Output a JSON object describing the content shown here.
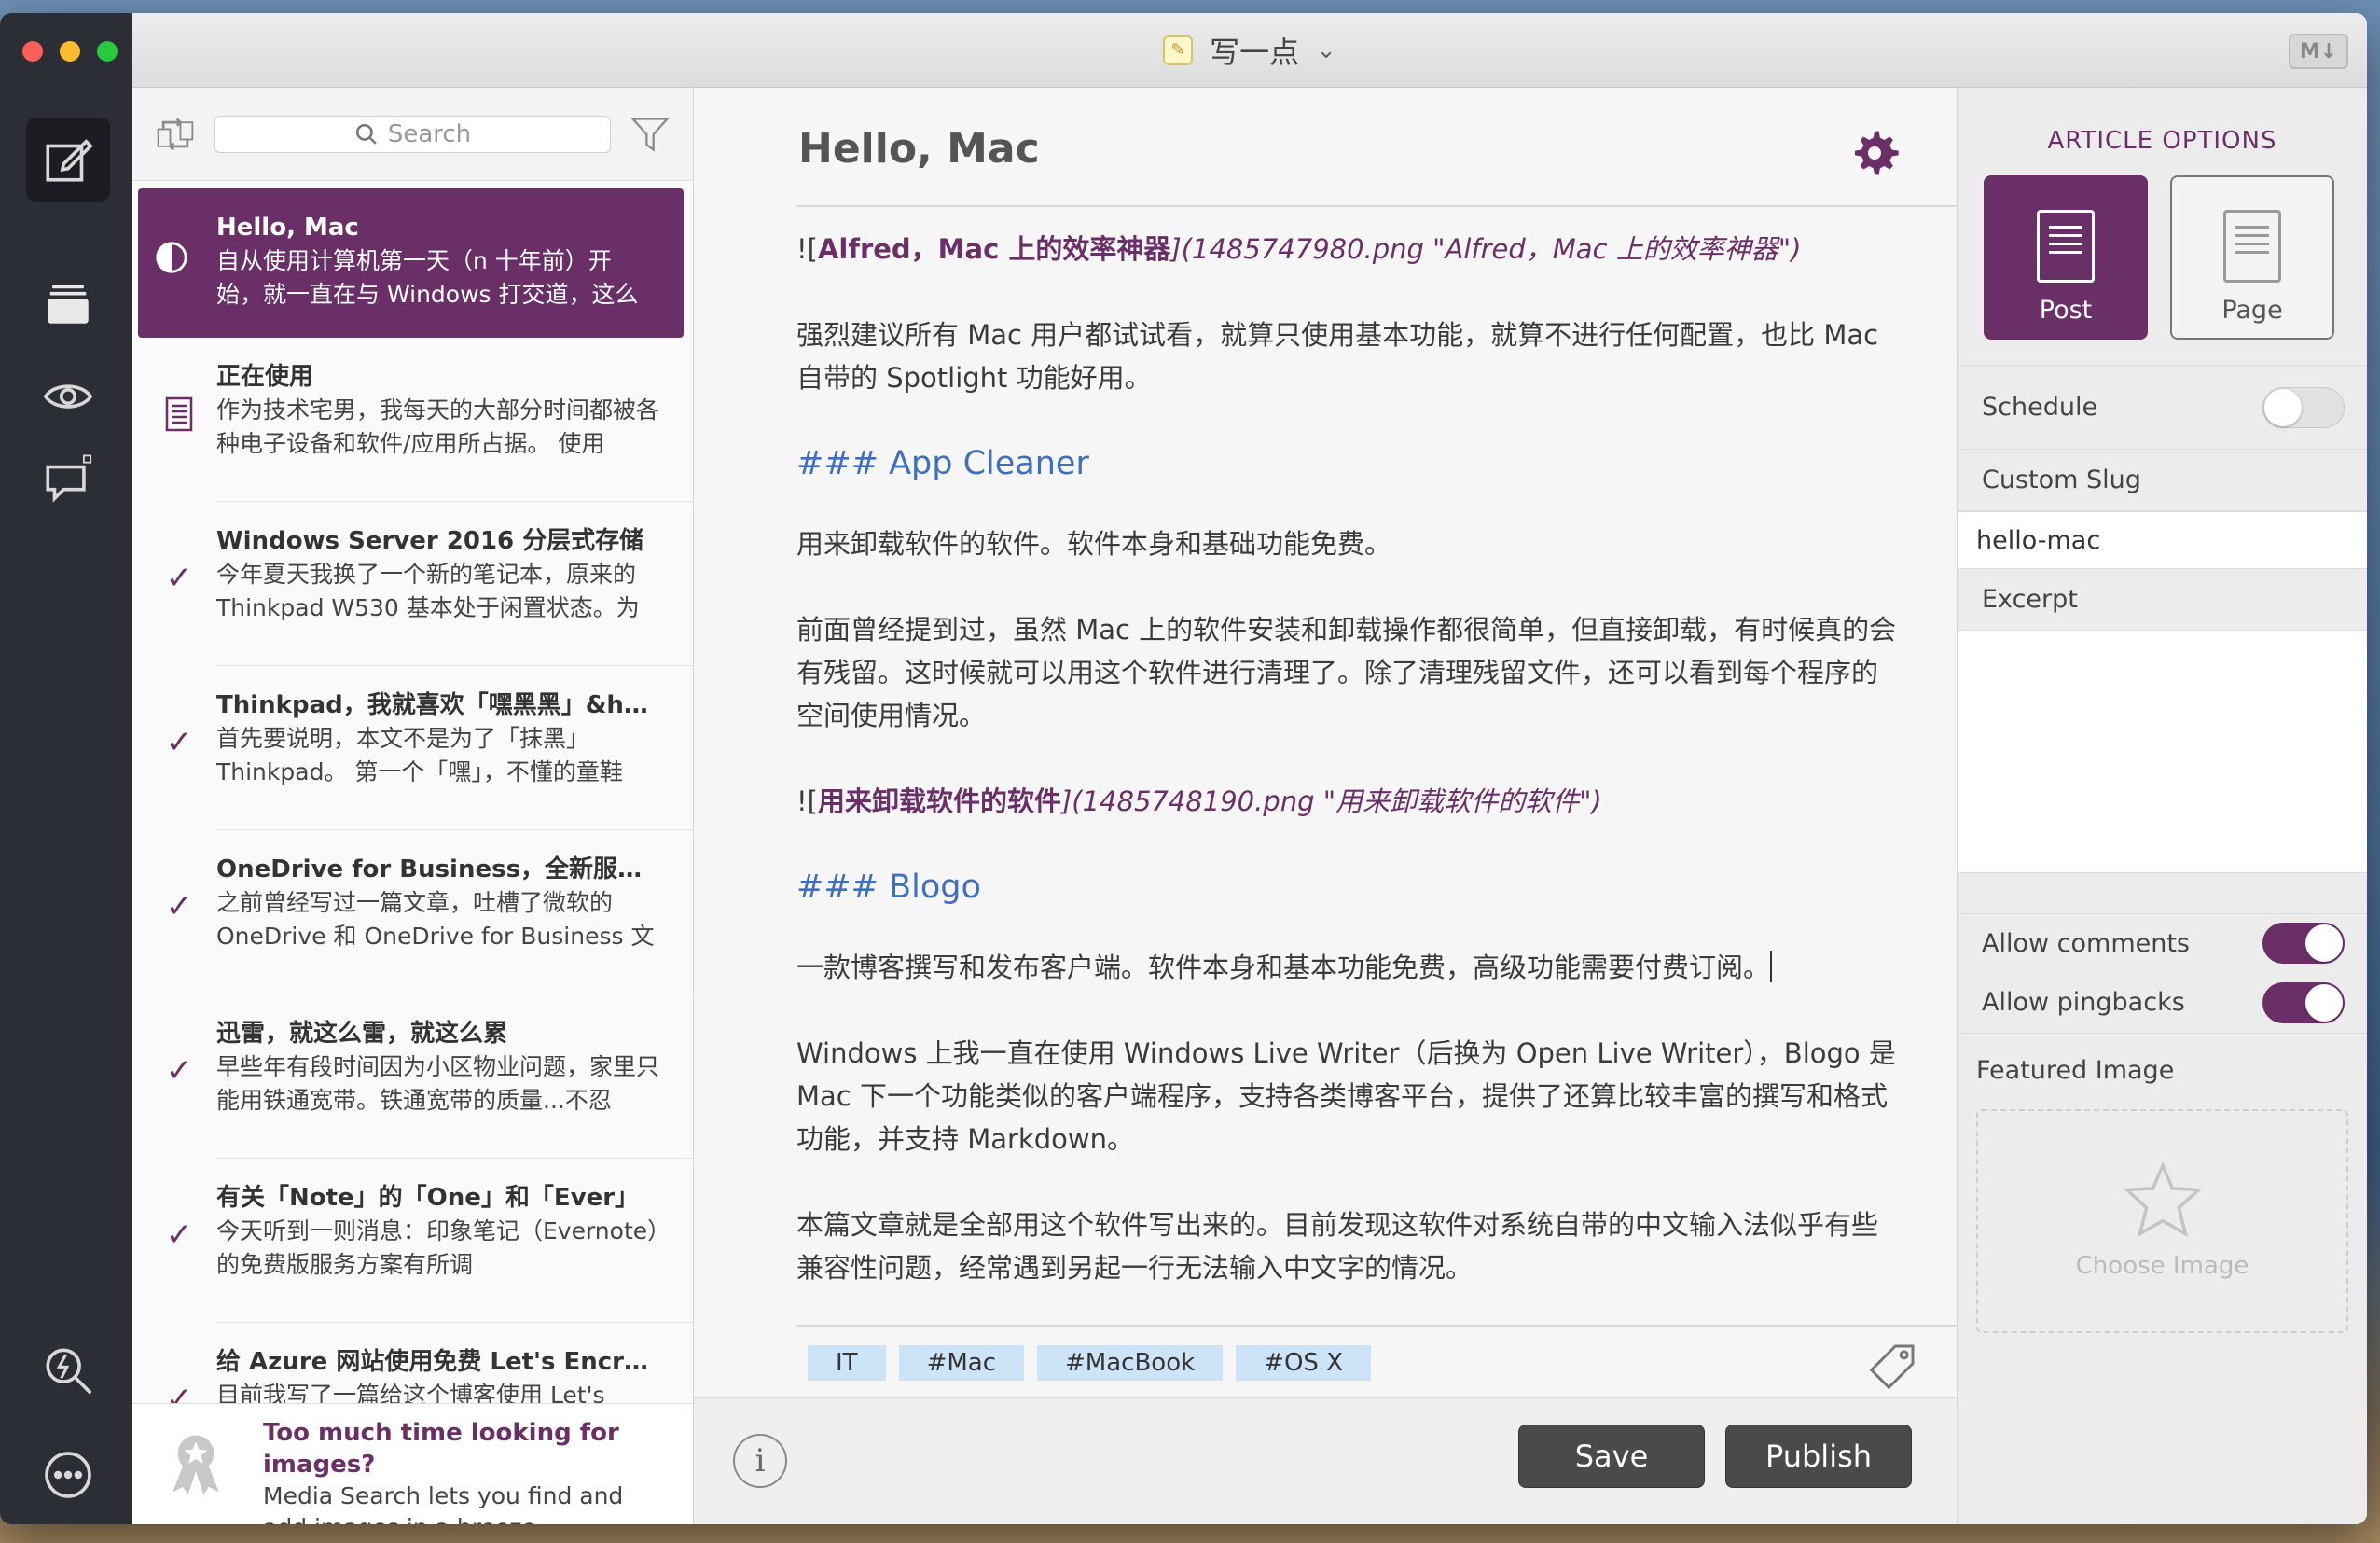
{
  "window": {
    "title": "写一点",
    "markdown_badge": "M↓"
  },
  "list": {
    "search_placeholder": "Search",
    "posts": [
      {
        "title": "Hello, Mac",
        "excerpt": "自从使用计算机第一天（n 十年前）开始，就一直在与 Windows 打交道，这么",
        "icon": "draft-half-circle-icon",
        "selected": true
      },
      {
        "title": "正在使用",
        "excerpt": "作为技术宅男，我每天的大部分时间都被各种电子设备和软件/应用所占据。 使用",
        "icon": "document-icon"
      },
      {
        "title": "Windows Server 2016 分层式存储",
        "excerpt": "今年夏天我换了一个新的笔记本，原来的 Thinkpad W530 基本处于闲置状态。为",
        "icon": "checkmark-icon"
      },
      {
        "title": "Thinkpad，我就喜欢「嘿黑黑」&hellip;",
        "excerpt": "首先要说明，本文不是为了「抹黑」 Thinkpad。 第一个「嘿」，不懂的童鞋",
        "icon": "checkmark-icon"
      },
      {
        "title": "OneDrive for Business，全新服务更...",
        "excerpt": "之前曾经写过一篇文章，吐槽了微软的 OneDrive 和 OneDrive for Business 文档",
        "icon": "checkmark-icon"
      },
      {
        "title": "迅雷，就这么雷，就这么累",
        "excerpt": "早些年有段时间因为小区物业问题，家里只能用铁通宽带。铁通宽带的质量...不忍",
        "icon": "checkmark-icon"
      },
      {
        "title": "有关「Note」的「One」和「Ever」",
        "excerpt": "今天听到一则消息：印象笔记（Evernote）的免费版服务方案有所调",
        "icon": "checkmark-icon"
      },
      {
        "title": "给 Azure 网站使用免费 Let's Encrypt...",
        "excerpt": "目前我写了一篇给这个博客使用 Let's",
        "icon": "checkmark-icon"
      }
    ],
    "promo": {
      "title": "Too much time looking for images?",
      "body": "Media Search lets you find and add images in a breeze."
    }
  },
  "editor": {
    "title": "Hello, Mac",
    "blocks": {
      "img1_prefix": "![",
      "img1_alt": "Alfred，Mac 上的效率神器",
      "img1_src": "](1485747980.png \"Alfred，Mac 上的效率神器\")",
      "p1": "强烈建议所有 Mac 用户都试试看，就算只使用基本功能，就算不进行任何配置，也比 Mac 自带的 Spotlight 功能好用。",
      "h1": "### App Cleaner",
      "p2": "用来卸载软件的软件。软件本身和基础功能免费。",
      "p3": "前面曾经提到过，虽然 Mac 上的软件安装和卸载操作都很简单，但直接卸载，有时候真的会有残留。这时候就可以用这个软件进行清理了。除了清理残留文件，还可以看到每个程序的空间使用情况。",
      "img2_prefix": "![",
      "img2_alt": "用来卸载软件的软件",
      "img2_src": "](1485748190.png \"用来卸载软件的软件\")",
      "h2": "### Blogo",
      "p4": "一款博客撰写和发布客户端。软件本身和基本功能免费，高级功能需要付费订阅。",
      "p5": "Windows 上我一直在使用 Windows Live Writer（后换为 Open Live Writer），Blogo 是 Mac 下一个功能类似的客户端程序，支持各类博客平台，提供了还算比较丰富的撰写和格式功能，并支持 Markdown。",
      "p6": "本篇文章就是全部用这个软件写出来的。目前发现这软件对系统自带的中文输入法似乎有些兼容性问题，经常遇到另起一行无法输入中文字的情况。"
    },
    "tags": [
      "IT",
      "#Mac",
      "#MacBook",
      "#OS X"
    ],
    "save_label": "Save",
    "publish_label": "Publish"
  },
  "options": {
    "heading": "ARTICLE OPTIONS",
    "post_label": "Post",
    "page_label": "Page",
    "schedule_label": "Schedule",
    "schedule_on": false,
    "custom_slug_label": "Custom Slug",
    "slug_value": "hello-mac",
    "excerpt_label": "Excerpt",
    "allow_comments_label": "Allow comments",
    "allow_comments_on": true,
    "allow_pingbacks_label": "Allow pingbacks",
    "allow_pingbacks_on": true,
    "featured_image_label": "Featured Image",
    "choose_image_label": "Choose Image"
  },
  "colors": {
    "accent": "#6b2f68",
    "heading_blue": "#3e6fc1",
    "tag_bg": "#cde3f7"
  }
}
